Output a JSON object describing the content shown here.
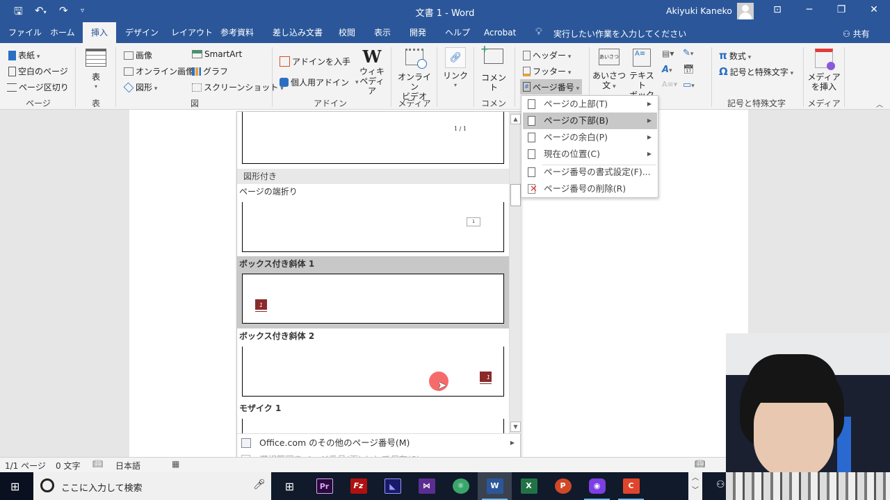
{
  "window": {
    "title": "文書 1  -  Word",
    "user_name": "Akiyuki Kaneko",
    "controls": {
      "ribbon_display": "⊡",
      "minimize": "─",
      "restore": "❐",
      "close": "✕"
    }
  },
  "quick_access": {
    "save": "save-icon",
    "undo": "undo-icon",
    "redo": "redo-icon",
    "customize": "customize-icon"
  },
  "tabs": [
    {
      "label": "ファイル"
    },
    {
      "label": "ホーム"
    },
    {
      "label": "挿入",
      "active": true
    },
    {
      "label": "デザイン"
    },
    {
      "label": "レイアウト"
    },
    {
      "label": "参考資料"
    },
    {
      "label": "差し込み文書"
    },
    {
      "label": "校閲"
    },
    {
      "label": "表示"
    },
    {
      "label": "開発"
    },
    {
      "label": "ヘルプ"
    },
    {
      "label": "Acrobat"
    }
  ],
  "tell_me": "実行したい作業を入力してください",
  "share": "共有",
  "ribbon": {
    "page_group": {
      "label": "ページ",
      "cover": "表紙",
      "blank": "空白のページ",
      "break": "ページ区切り"
    },
    "table_group": {
      "label": "表",
      "table": "表"
    },
    "illustrations": {
      "label": "図",
      "picture": "画像",
      "online_picture": "オンライン画像",
      "shapes": "図形",
      "smartart": "SmartArt",
      "chart": "グラフ",
      "screenshot": "スクリーンショット"
    },
    "addins": {
      "label": "アドイン",
      "get": "アドインを入手",
      "my": "個人用アドイン",
      "wiki_l1": "ウィキ",
      "wiki_l2": "ペディア"
    },
    "media": {
      "label": "メディア",
      "online_video_l1": "オンライン",
      "online_video_l2": "ビデオ"
    },
    "links": {
      "label": "リンク"
    },
    "comments": {
      "label": "コメント",
      "comment": "コメント"
    },
    "header_footer": {
      "header": "ヘッダー",
      "footer": "フッター",
      "page_number": "ページ番号"
    },
    "text": {
      "greeting_l1": "あいさつ",
      "greeting_l2": "文",
      "textbox_l1": "テキスト",
      "textbox_l2": "ボックス",
      "greeting_icon_text": "あいさつ"
    },
    "symbols": {
      "label": "記号と特殊文字",
      "equation": "数式",
      "symbol": "記号と特殊文字"
    },
    "media2": {
      "label": "メディア",
      "insert_l1": "メディア",
      "insert_l2": "を挿入"
    }
  },
  "page_number_menu": {
    "items": [
      {
        "label": "ページの上部(T)",
        "submenu": true
      },
      {
        "label": "ページの下部(B)",
        "submenu": true,
        "selected": true
      },
      {
        "label": "ページの余白(P)",
        "submenu": true
      },
      {
        "label": "現在の位置(C)",
        "submenu": true
      },
      {
        "label": "ページ番号の書式設定(F)...",
        "submenu": false
      },
      {
        "label": "ページ番号の削除(R)",
        "submenu": false
      }
    ]
  },
  "gallery": {
    "first_thumb_text": "1 / 1",
    "section_header": "図形付き",
    "items": [
      {
        "name": "ページの端折り",
        "thumb_text": "1"
      },
      {
        "name": "ボックス付き斜体 1",
        "thumb_text": "1",
        "hovered": true
      },
      {
        "name": "ボックス付き斜体 2",
        "thumb_text": "1"
      },
      {
        "name": "モザイク 1"
      }
    ],
    "footer": {
      "more": "Office.com のその他のページ番号(M)",
      "save_selection": "選択範囲をページ番号(下) として保存(S)"
    },
    "accent_color": "#8b2a2a"
  },
  "status": {
    "page": "1/1 ページ",
    "words": "0 文字",
    "language": "日本語"
  },
  "taskbar": {
    "search_placeholder": "ここに入力して検索",
    "apps": [
      {
        "name": "task-view",
        "label": "⊞"
      },
      {
        "name": "premiere",
        "label": "Pr",
        "color": "#2a0a3a",
        "fg": "#d9a4ff"
      },
      {
        "name": "filezilla",
        "label": "Fz",
        "color": "#b01010",
        "fg": "#ffffff"
      },
      {
        "name": "app-dark-blue",
        "label": "◣",
        "color": "#1a1a6a",
        "fg": "#9a9aff"
      },
      {
        "name": "visual-studio",
        "label": "⋈",
        "color": "#5c2d91",
        "fg": "#ffffff"
      },
      {
        "name": "atom",
        "label": "⚛",
        "color": "#3aa66a",
        "fg": "#ffffff"
      },
      {
        "name": "word",
        "label": "W",
        "color": "#2b579a",
        "fg": "#ffffff",
        "active": true
      },
      {
        "name": "excel",
        "label": "X",
        "color": "#217346",
        "fg": "#ffffff"
      },
      {
        "name": "powerpoint",
        "label": "P",
        "color": "#d24726",
        "fg": "#ffffff"
      },
      {
        "name": "screen-recorder",
        "label": "◉",
        "color": "#7b3fe4",
        "fg": "#ffffff"
      },
      {
        "name": "camtasia",
        "label": "C",
        "color": "#e0452b",
        "fg": "#ffffff"
      }
    ]
  }
}
